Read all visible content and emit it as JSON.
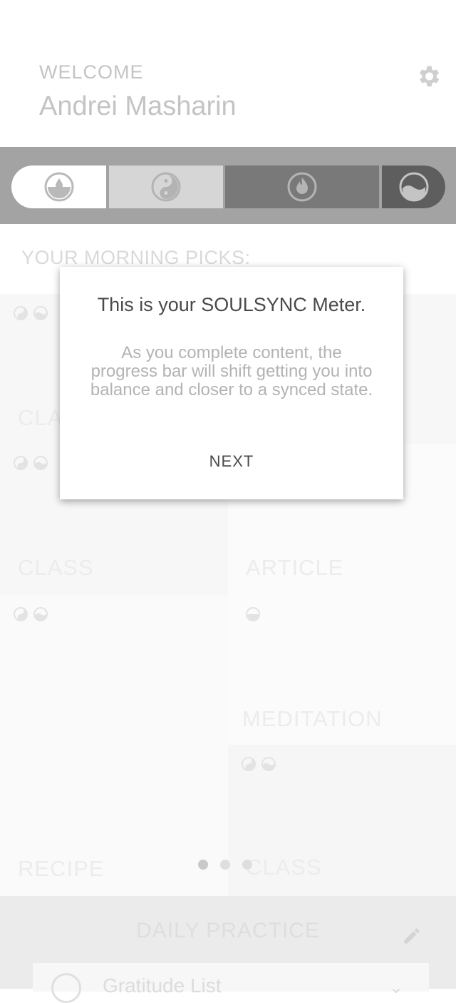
{
  "header": {
    "welcome_label": "WELCOME",
    "user_name": "Andrei Masharin",
    "settings_icon": "gear-icon"
  },
  "meter": {
    "segments": [
      {
        "icon": "water-drop-icon",
        "color": "#ffffff"
      },
      {
        "icon": "yin-yang-icon",
        "color": "#d6d6d6"
      },
      {
        "icon": "fire-icon",
        "color": "#797979"
      },
      {
        "icon": "wave-icon",
        "color": "#5e5e5e"
      }
    ]
  },
  "picks": {
    "title": "YOUR MORNING PICKS:",
    "tiles": [
      {
        "label": "CLASS"
      },
      {
        "label": "CLASS"
      },
      {
        "label": "ARTICLE"
      },
      {
        "label": "MEDITATION"
      },
      {
        "label": "RECIPE"
      },
      {
        "label": "CLASS"
      }
    ]
  },
  "pager": {
    "pages": 3,
    "active": 1
  },
  "daily": {
    "title": "DAILY PRACTICE",
    "item_label": "Gratitude List"
  },
  "tutorial": {
    "title": "This is your SOULSYNC Meter.",
    "body": "As you complete content, the progress bar will shift getting you into balance and closer to a synced state.",
    "next_label": "NEXT"
  }
}
